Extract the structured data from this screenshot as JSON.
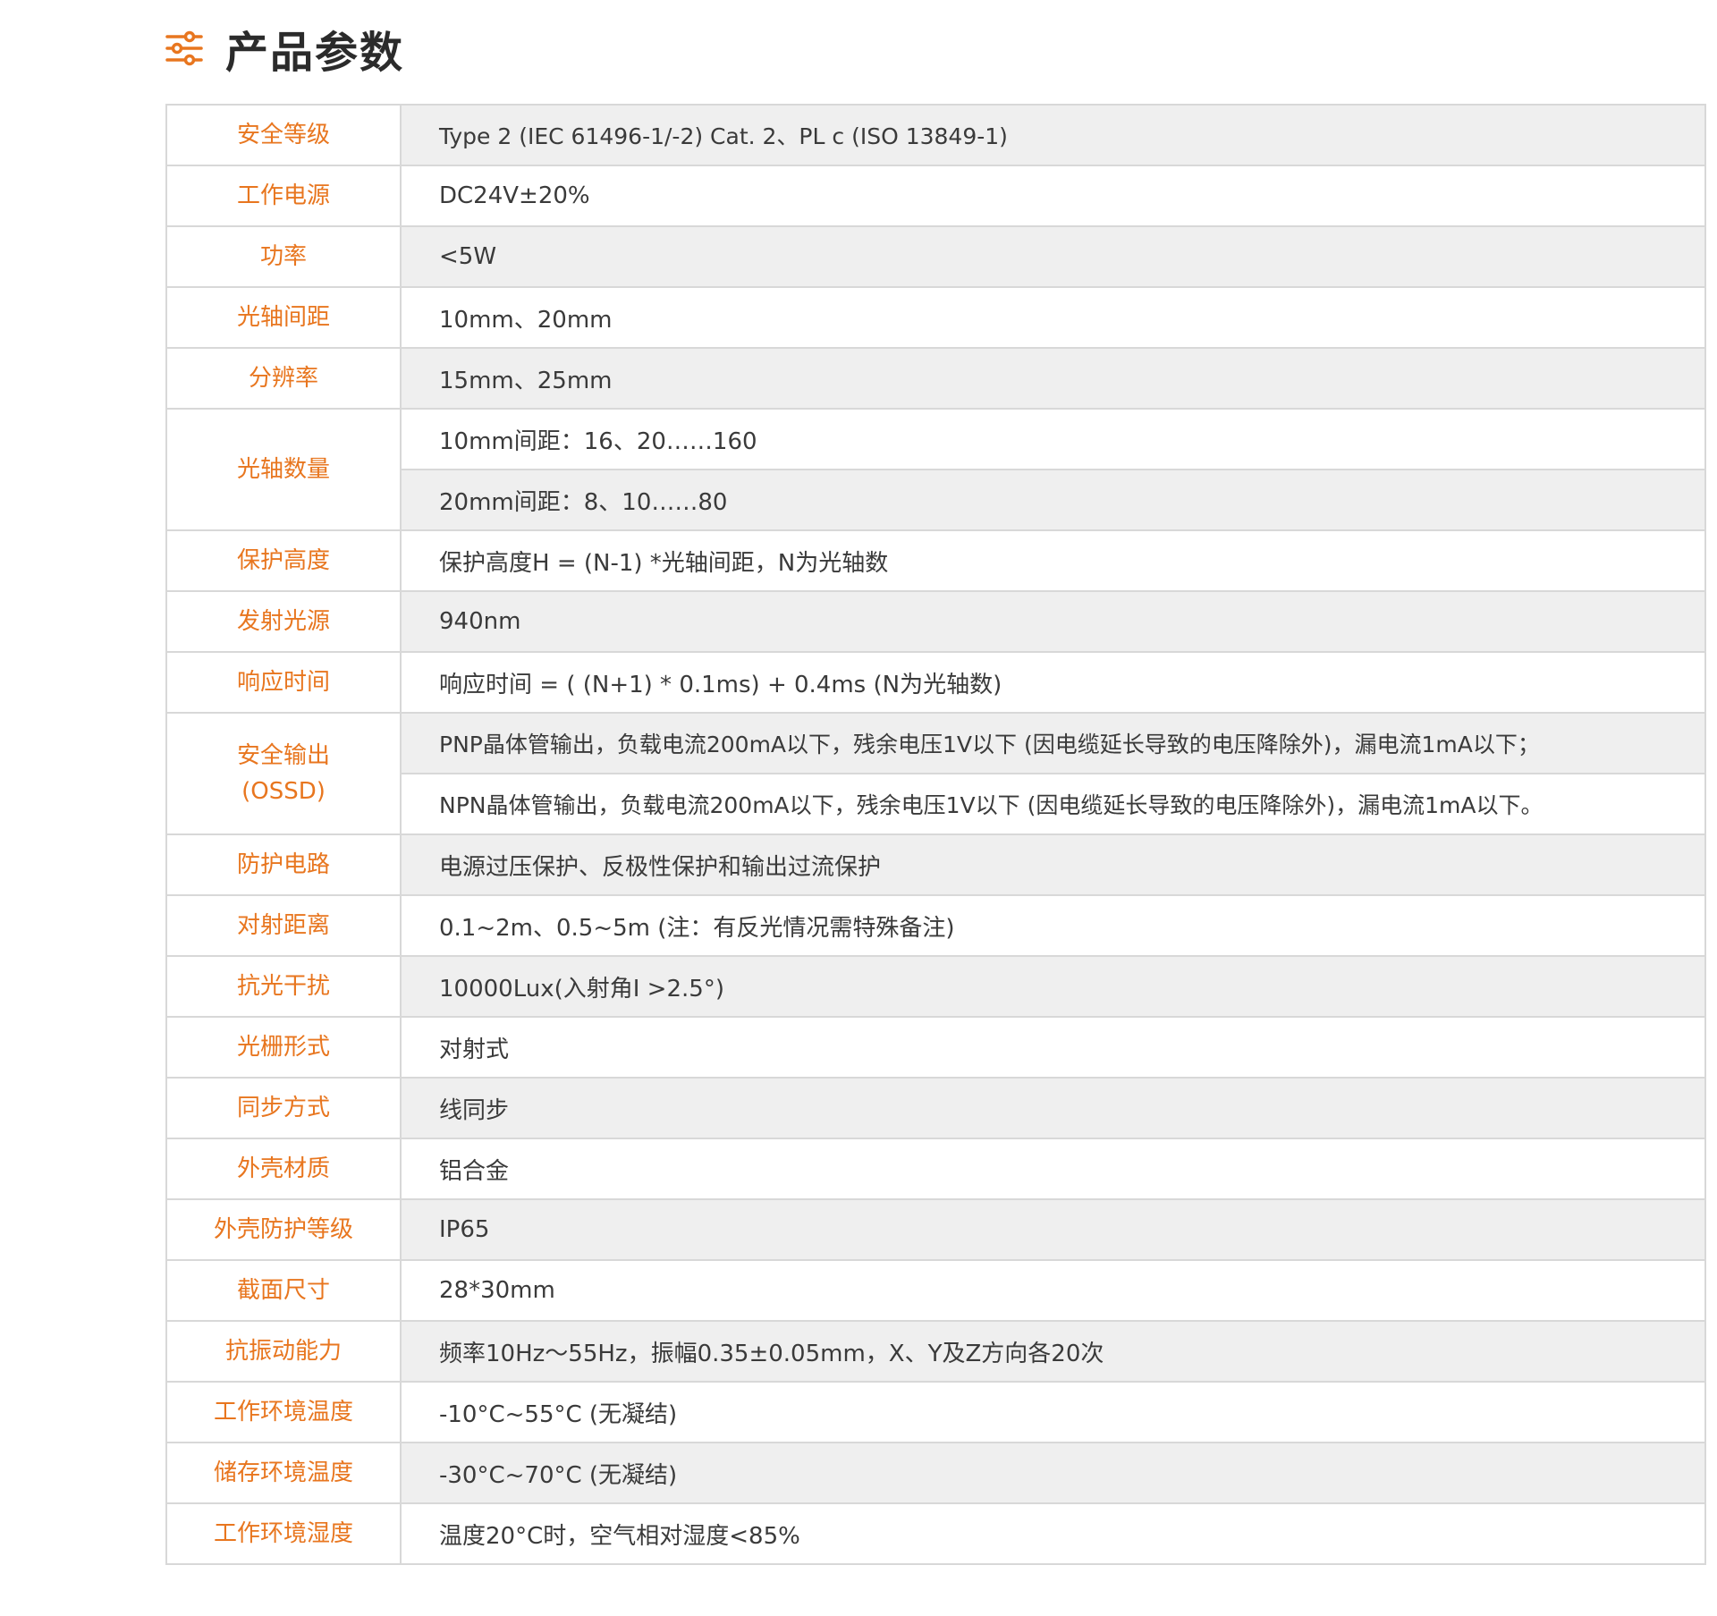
{
  "header": {
    "icon": "sliders-icon",
    "title": "产品参数",
    "accent_color": "#e8761f"
  },
  "rows": [
    {
      "label": "安全等级",
      "values": [
        "Type 2 (IEC 61496-1/-2) Cat. 2、PL c (ISO 13849-1)"
      ]
    },
    {
      "label": "工作电源",
      "values": [
        "DC24V±20%"
      ]
    },
    {
      "label": "功率",
      "values": [
        "<5W"
      ]
    },
    {
      "label": "光轴间距",
      "values": [
        "10mm、20mm"
      ]
    },
    {
      "label": "分辨率",
      "values": [
        "15mm、25mm"
      ]
    },
    {
      "label": "光轴数量",
      "values": [
        "10mm间距：16、20……160",
        "20mm间距：8、10……80"
      ]
    },
    {
      "label": "保护高度",
      "values": [
        "保护高度H = (N-1) *光轴间距，N为光轴数"
      ]
    },
    {
      "label": "发射光源",
      "values": [
        "940nm"
      ]
    },
    {
      "label": "响应时间",
      "values": [
        "响应时间 = ( (N+1) * 0.1ms) + 0.4ms (N为光轴数)"
      ]
    },
    {
      "label": "安全输出\n(OSSD)",
      "values": [
        "PNP晶体管输出，负载电流200mA以下，残余电压1V以下 (因电缆延长导致的电压降除外)，漏电流1mA以下；",
        "NPN晶体管输出，负载电流200mA以下，残余电压1V以下 (因电缆延长导致的电压降除外)，漏电流1mA以下。"
      ]
    },
    {
      "label": "防护电路",
      "values": [
        "电源过压保护、反极性保护和输出过流保护"
      ]
    },
    {
      "label": "对射距离",
      "values": [
        "0.1~2m、0.5~5m (注：有反光情况需特殊备注)"
      ]
    },
    {
      "label": "抗光干扰",
      "values": [
        "10000Lux(入射角I >2.5°)"
      ]
    },
    {
      "label": "光栅形式",
      "values": [
        "对射式"
      ]
    },
    {
      "label": "同步方式",
      "values": [
        "线同步"
      ]
    },
    {
      "label": "外壳材质",
      "values": [
        "铝合金"
      ]
    },
    {
      "label": "外壳防护等级",
      "values": [
        "IP65"
      ]
    },
    {
      "label": "截面尺寸",
      "values": [
        "28*30mm"
      ]
    },
    {
      "label": "抗振动能力",
      "values": [
        "频率10Hz～55Hz，振幅0.35±0.05mm，X、Y及Z方向各20次"
      ]
    },
    {
      "label": "工作环境温度",
      "values": [
        "-10°C~55°C (无凝结)"
      ]
    },
    {
      "label": "储存环境温度",
      "values": [
        "-30°C~70°C (无凝结)"
      ]
    },
    {
      "label": "工作环境湿度",
      "values": [
        "温度20°C时，空气相对湿度<85%"
      ]
    }
  ]
}
